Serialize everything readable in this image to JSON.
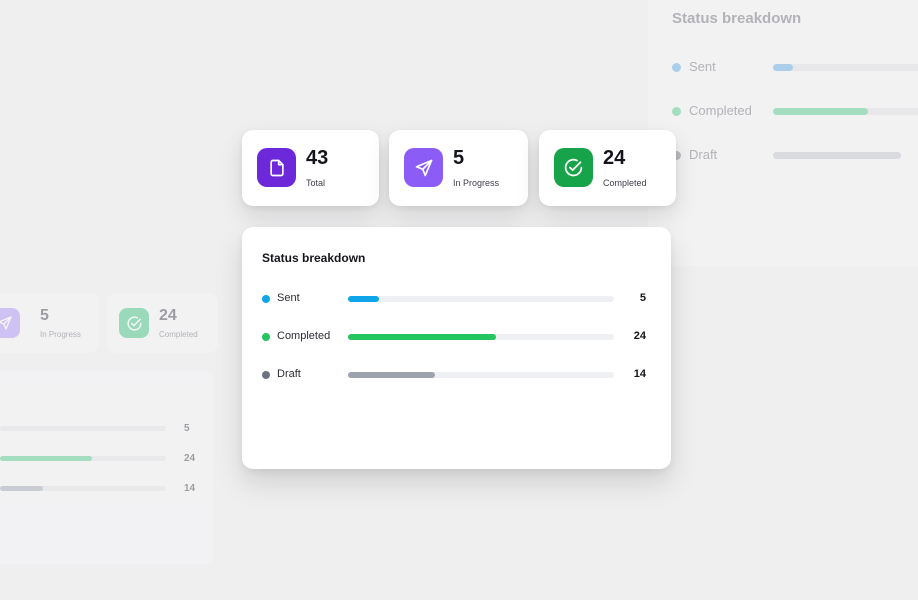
{
  "stats": [
    {
      "value": "43",
      "caption": "Total",
      "icon": "document-icon",
      "color": "#6d28d9"
    },
    {
      "value": "5",
      "caption": "In Progress",
      "icon": "send-icon",
      "color": "#8b5cf6"
    },
    {
      "value": "24",
      "caption": "Completed",
      "icon": "check-circle-icon",
      "color": "#16a34a"
    }
  ],
  "breakdown": {
    "title": "Status breakdown",
    "max": 43,
    "rows": [
      {
        "label": "Sent",
        "value": 5,
        "value_text": "5",
        "color": "#0ea5e9"
      },
      {
        "label": "Completed",
        "value": 24,
        "value_text": "24",
        "color": "#22c55e"
      },
      {
        "label": "Draft",
        "value": 14,
        "value_text": "14",
        "color": "#9ca3af"
      }
    ]
  },
  "colors": {
    "background": "#efeff0",
    "card": "#ffffff",
    "draft_dot": "#6b7280"
  }
}
